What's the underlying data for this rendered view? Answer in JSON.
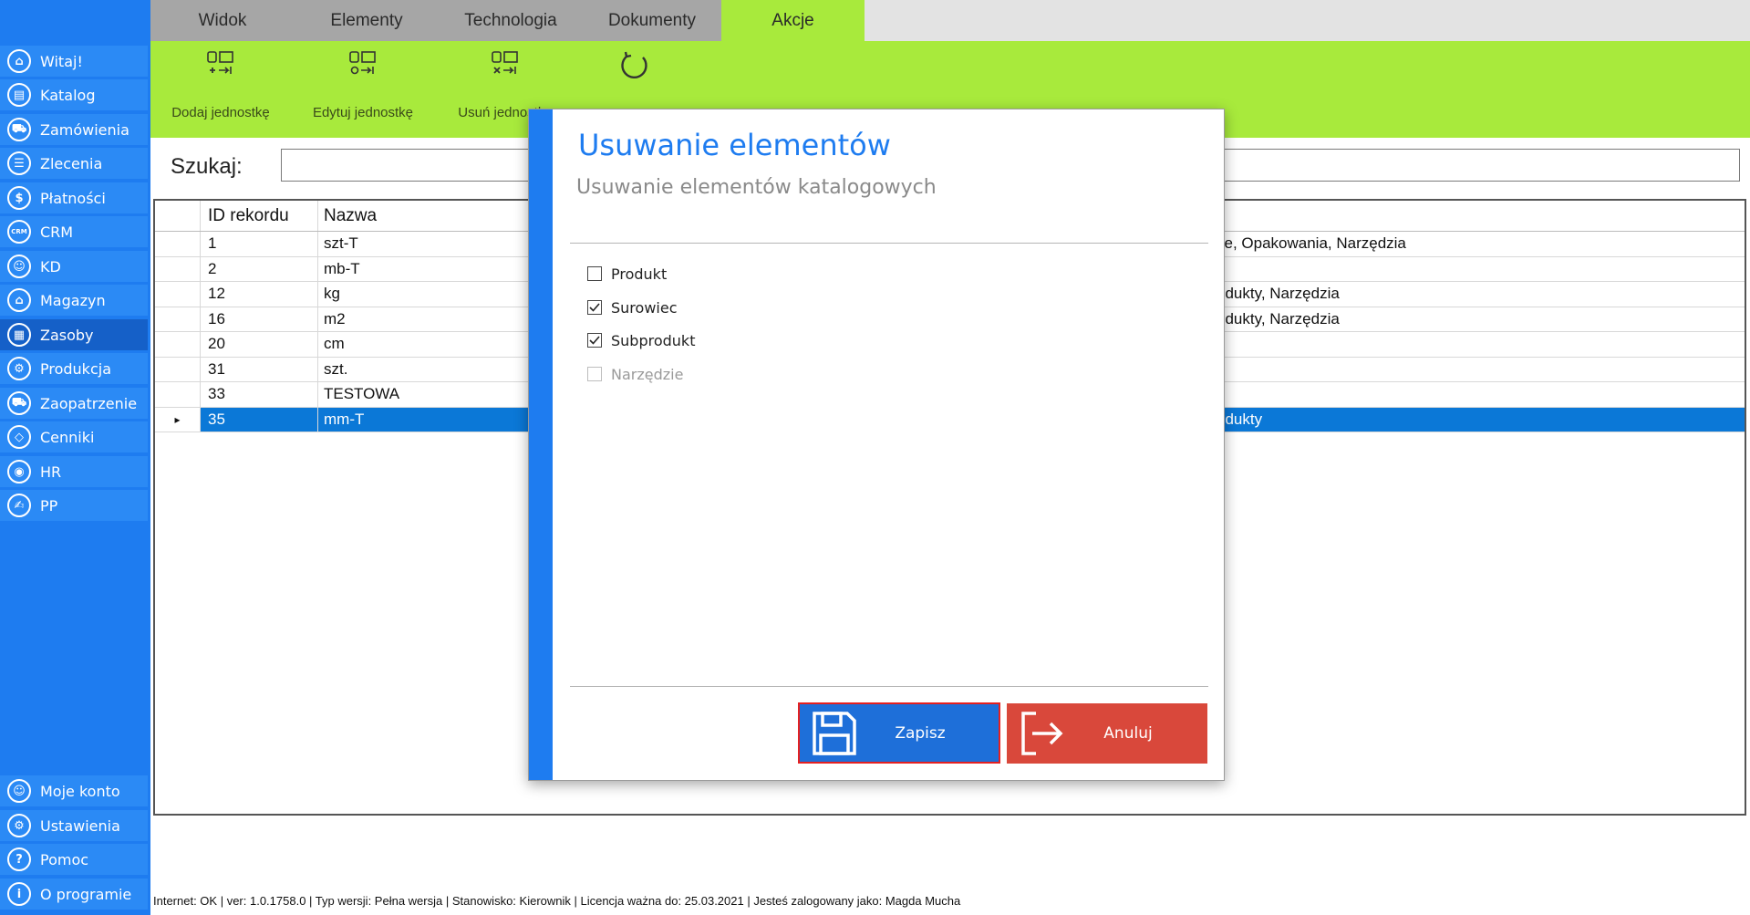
{
  "sidebar": {
    "items": [
      {
        "label": "Witaj!",
        "icon": "home-icon",
        "glyph": "⌂"
      },
      {
        "label": "Katalog",
        "icon": "book-icon",
        "glyph": "▤"
      },
      {
        "label": "Zamówienia",
        "icon": "cart-icon",
        "glyph": "⛟"
      },
      {
        "label": "Zlecenia",
        "icon": "list-icon",
        "glyph": "☰"
      },
      {
        "label": "Płatności",
        "icon": "dollar-icon",
        "glyph": "$"
      },
      {
        "label": "CRM",
        "icon": "crm-icon",
        "glyph": "CRM"
      },
      {
        "label": "KD",
        "icon": "user-icon",
        "glyph": "☺"
      },
      {
        "label": "Magazyn",
        "icon": "warehouse-icon",
        "glyph": "⌂"
      },
      {
        "label": "Zasoby",
        "icon": "resources-icon",
        "glyph": "▦"
      },
      {
        "label": "Produkcja",
        "icon": "production-icon",
        "glyph": "⚙"
      },
      {
        "label": "Zaopatrzenie",
        "icon": "truck-icon",
        "glyph": "⛟"
      },
      {
        "label": "Cenniki",
        "icon": "tag-icon",
        "glyph": "◇"
      },
      {
        "label": "HR",
        "icon": "hr-icon",
        "glyph": "◉"
      },
      {
        "label": "PP",
        "icon": "pp-icon",
        "glyph": "✍"
      }
    ],
    "bottom_items": [
      {
        "label": "Moje konto",
        "icon": "account-icon",
        "glyph": "☺"
      },
      {
        "label": "Ustawienia",
        "icon": "settings-icon",
        "glyph": "⚙"
      },
      {
        "label": "Pomoc",
        "icon": "help-icon",
        "glyph": "?"
      },
      {
        "label": "O programie",
        "icon": "info-icon",
        "glyph": "i"
      }
    ]
  },
  "tabs": [
    "Widok",
    "Elementy",
    "Technologia",
    "Dokumenty",
    "Akcje"
  ],
  "ribbon": {
    "buttons": [
      "Dodaj jednostkę",
      "Edytuj jednostkę",
      "Usuń jednostkę",
      ""
    ]
  },
  "search": {
    "label": "Szukaj:",
    "value": ""
  },
  "grid": {
    "headers": [
      "ID rekordu",
      "Nazwa",
      ""
    ],
    "rows": [
      {
        "id": "1",
        "name": "szt-T",
        "extra": "ce, Opakowania, Narzędzia"
      },
      {
        "id": "2",
        "name": "mb-T",
        "extra": ""
      },
      {
        "id": "12",
        "name": "kg",
        "extra": "odukty, Narzędzia"
      },
      {
        "id": "16",
        "name": "m2",
        "extra": "odukty, Narzędzia"
      },
      {
        "id": "20",
        "name": "cm",
        "extra": ""
      },
      {
        "id": "31",
        "name": "szt.",
        "extra": ""
      },
      {
        "id": "33",
        "name": "TESTOWA",
        "extra": ""
      },
      {
        "id": "35",
        "name": "mm-T",
        "extra": "odukty",
        "selected": true,
        "marker": "▸"
      }
    ]
  },
  "dialog": {
    "title": "Usuwanie elementów",
    "subtitle": "Usuwanie elementów katalogowych",
    "options": [
      {
        "label": "Produkt",
        "checked": false,
        "disabled": false
      },
      {
        "label": "Surowiec",
        "checked": true,
        "disabled": false
      },
      {
        "label": "Subprodukt",
        "checked": true,
        "disabled": false
      },
      {
        "label": "Narzędzie",
        "checked": false,
        "disabled": true
      }
    ],
    "save_label": "Zapisz",
    "cancel_label": "Anuluj"
  },
  "statusbar": {
    "text": "Internet: OK  |   ver: 1.0.1758.0   |   Typ wersji: Pełna wersja   |   Stanowisko: Kierownik   |   Licencja ważna do: 25.03.2021   |   Jesteś zalogowany jako: Magda Mucha"
  },
  "colors": {
    "sidebar": "#1e7cf0",
    "ribbon": "#a8ea3c",
    "selected_row": "#0b78d7",
    "save_button": "#1e6fd9",
    "cancel_button": "#d9483b"
  }
}
